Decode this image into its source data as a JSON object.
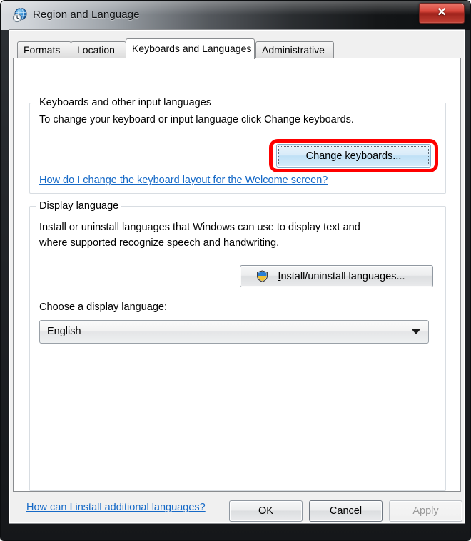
{
  "window": {
    "title": "Region and Language",
    "icon": "region-language-globe-clock-icon",
    "close_label": "✕"
  },
  "tabs": [
    {
      "label": "Formats",
      "active": false
    },
    {
      "label": "Location",
      "active": false
    },
    {
      "label": "Keyboards and Languages",
      "active": true
    },
    {
      "label": "Administrative",
      "active": false
    }
  ],
  "keyboards_group": {
    "title": "Keyboards and other input languages",
    "description": "To change your keyboard or input language click Change keyboards.",
    "change_keyboards_button": {
      "prefix": "",
      "accel": "C",
      "rest": "hange keyboards..."
    },
    "help_link": "How do I change the keyboard layout for the Welcome screen?"
  },
  "display_group": {
    "title": "Display language",
    "description_line1": "Install or uninstall languages that Windows can use to display text and",
    "description_line2": "where supported recognize speech and handwriting.",
    "install_button": {
      "icon": "uac-shield-icon",
      "accel": "I",
      "rest": "nstall/uninstall languages..."
    },
    "choose_label": {
      "prefix": "C",
      "accel": "h",
      "rest": "oose a display language:"
    },
    "combo": {
      "value": "English",
      "options": [
        "English"
      ],
      "arrow_icon": "chevron-down-icon"
    }
  },
  "footer_link": "How can I install additional languages?",
  "dialog_buttons": {
    "ok": "OK",
    "cancel": "Cancel",
    "apply": {
      "accel": "A",
      "rest": "pply",
      "enabled": false
    }
  },
  "colors": {
    "highlight_ring": "#ff0000",
    "link": "#1569c7",
    "accent_button": "#bfe0f6",
    "close_button": "#d8453a"
  }
}
